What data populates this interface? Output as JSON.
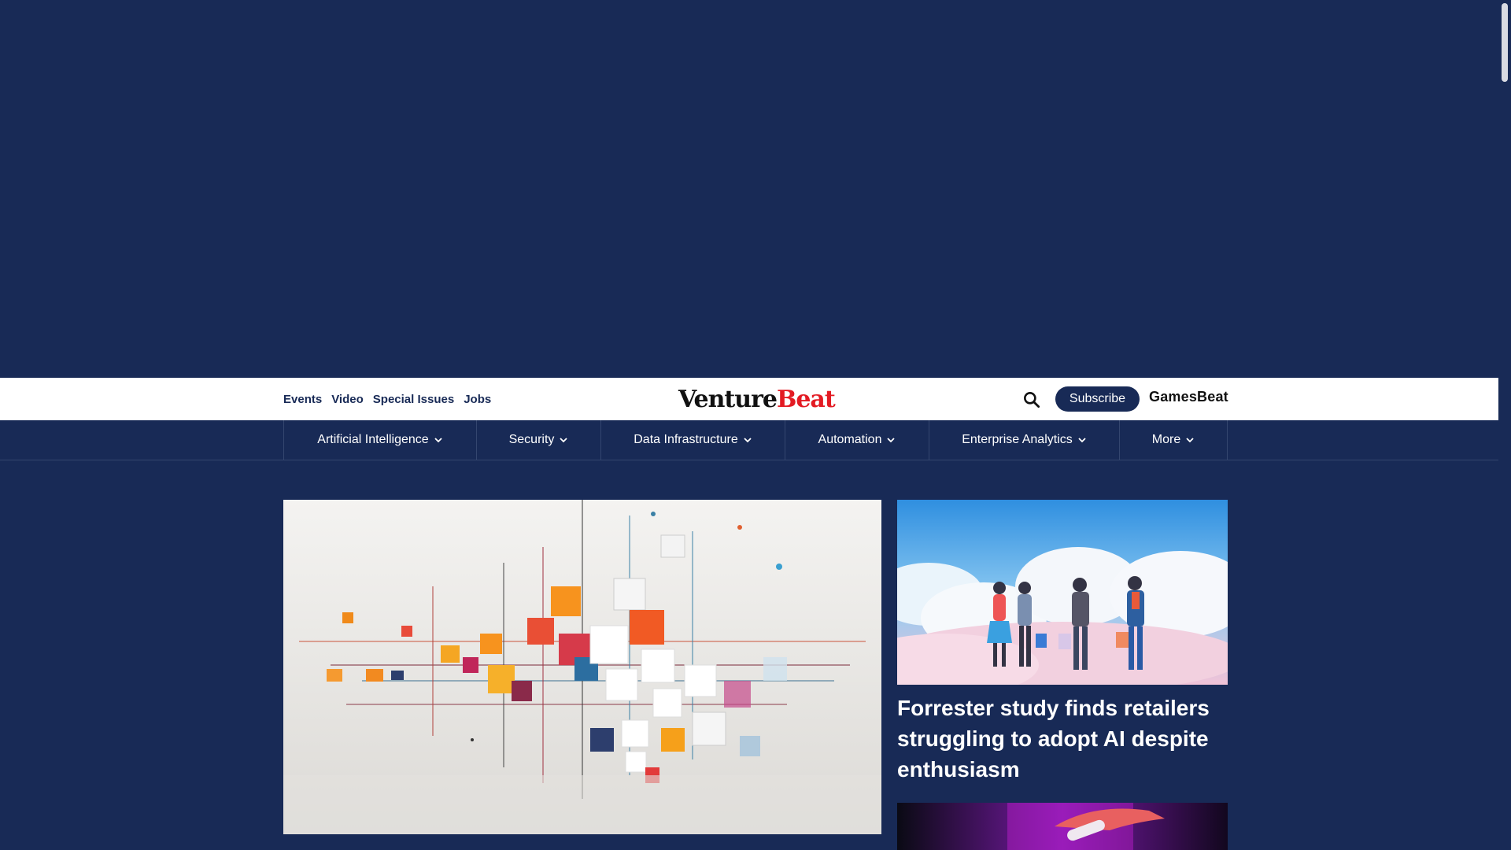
{
  "colors": {
    "navy": "#182a56",
    "brand_red": "#e31b23",
    "white": "#ffffff"
  },
  "utility_nav": [
    {
      "label": "Events"
    },
    {
      "label": "Video"
    },
    {
      "label": "Special Issues"
    },
    {
      "label": "Jobs"
    }
  ],
  "logo": {
    "part1": "Venture",
    "part2": "Beat"
  },
  "header_actions": {
    "search_icon": "search-icon",
    "subscribe_label": "Subscribe",
    "sister_site": "GamesBeat"
  },
  "categories": [
    {
      "label": "Artificial Intelligence"
    },
    {
      "label": "Security"
    },
    {
      "label": "Data Infrastructure"
    },
    {
      "label": "Automation"
    },
    {
      "label": "Enterprise Analytics"
    },
    {
      "label": "More"
    }
  ],
  "featured": {
    "side_story_title": "Forrester study finds retailers struggling to adopt AI despite enthusiasm"
  }
}
